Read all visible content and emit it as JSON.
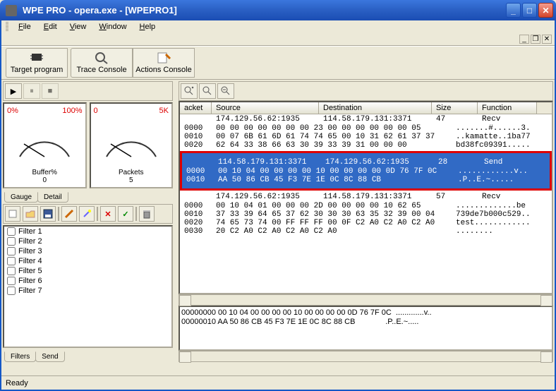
{
  "window": {
    "title": "WPE PRO - opera.exe - [WPEPRO1]"
  },
  "menu": {
    "file": "File",
    "edit": "Edit",
    "view": "View",
    "window": "Window",
    "help": "Help"
  },
  "toolbar": {
    "target": "Target program",
    "trace": "Trace Console",
    "actions": "Actions Console"
  },
  "gauge": {
    "buffer_label": "Buffer%",
    "buffer_value": "0",
    "buffer_min": "0%",
    "buffer_max": "100%",
    "packets_label": "Packets",
    "packets_value": "5",
    "packets_min": "0",
    "packets_max": "5K"
  },
  "left_tabs": {
    "gauge": "Gauge",
    "detail": "Detail",
    "filters": "Filters",
    "send": "Send"
  },
  "filters": [
    "Filter 1",
    "Filter 2",
    "Filter 3",
    "Filter 4",
    "Filter 5",
    "Filter 6",
    "Filter 7"
  ],
  "grid_cols": {
    "packet": "acket",
    "source": "Source",
    "dest": "Destination",
    "size": "Size",
    "func": "Function"
  },
  "packets": [
    {
      "source": "174.129.56.62:1935",
      "dest": "114.58.179.131:3371",
      "size": "47",
      "func": "Recv",
      "hex": [
        {
          "off": "0000",
          "data": "00 00 00 00 00 00 00 23 00 00 00 00 00 00 05",
          "asc": ".......#......3."
        },
        {
          "off": "0010",
          "data": "00 07 6B 61 6D 61 74 74 65 00 10 31 62 61 37 37",
          "asc": "..kamatte..1ba77"
        },
        {
          "off": "0020",
          "data": "62 64 33 38 66 63 30 39 33 39 31 00 00 00",
          "asc": "bd38fc09391....."
        }
      ]
    },
    {
      "source": "114.58.179.131:3371",
      "dest": "174.129.56.62:1935",
      "size": "28",
      "func": "Send",
      "highlight": true,
      "hex": [
        {
          "off": "0000",
          "data": "00 10 04 00 00 00 00 10 00 00 00 00 0D 76 7F 0C",
          "asc": "............v.."
        },
        {
          "off": "0010",
          "data": "AA 50 86 CB 45 F3 7E 1E 0C 8C 88 CB",
          "asc": ".P..E.~....."
        }
      ]
    },
    {
      "source": "174.129.56.62:1935",
      "dest": "114.58.179.131:3371",
      "size": "57",
      "func": "Recv",
      "hex": [
        {
          "off": "0000",
          "data": "00 10 04 01 00 00 00 2D 00 00 00 00 10 62 65",
          "asc": ".............be"
        },
        {
          "off": "0010",
          "data": "37 33 39 64 65 37 62 30 30 30 63 35 32 39 00 04",
          "asc": "739de7b000c529.."
        },
        {
          "off": "0020",
          "data": "74 65 73 74 00 FF FF FF 00 0F C2 A0 C2 A0 C2 A0",
          "asc": "test............"
        },
        {
          "off": "0030",
          "data": "20 C2 A0 C2 A0 C2 A0 C2 A0",
          "asc": "........"
        }
      ]
    }
  ],
  "lower": {
    "line1": "00000000 00 10 04 00 00 00 00 10 00 00 00 00 0D 76 7F 0C  .............v..",
    "line2": "00000010 AA 50 86 CB 45 F3 7E 1E 0C 8C 88 CB              .P..E.~....."
  },
  "status": "Ready"
}
